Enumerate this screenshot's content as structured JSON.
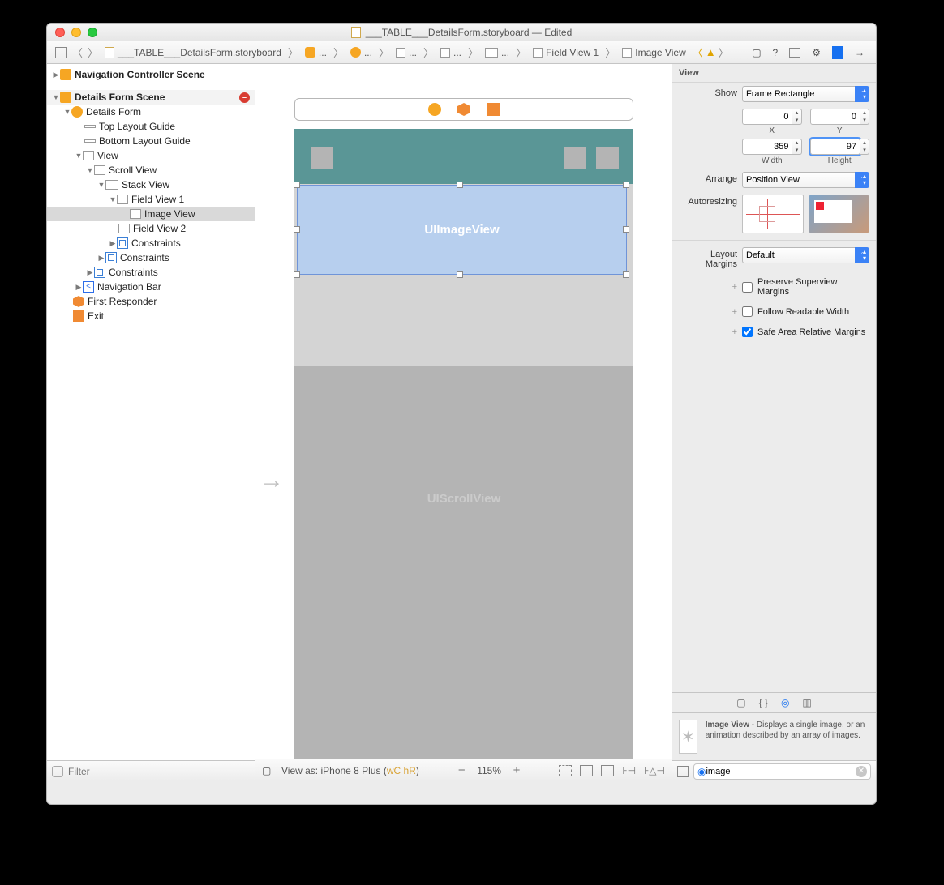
{
  "window": {
    "title": "___TABLE___DetailsForm.storyboard — Edited"
  },
  "breadcrumbs": {
    "file": "___TABLE___DetailsForm.storyboard",
    "p1": "...",
    "p2": "...",
    "p3": "...",
    "p4": "...",
    "p5": "...",
    "field": "Field View 1",
    "image": "Image View"
  },
  "outline": {
    "navScene": "Navigation Controller Scene",
    "detailsScene": "Details Form Scene",
    "items": {
      "detailsForm": "Details Form",
      "topGuide": "Top Layout Guide",
      "bottomGuide": "Bottom Layout Guide",
      "view": "View",
      "scrollView": "Scroll View",
      "stackView": "Stack View",
      "fieldView1": "Field View 1",
      "imageView": "Image View",
      "fieldView2": "Field View 2",
      "constraints1": "Constraints",
      "constraints2": "Constraints",
      "constraints3": "Constraints",
      "navBar": "Navigation Bar",
      "firstResponder": "First Responder",
      "exit": "Exit"
    },
    "filterPlaceholder": "Filter"
  },
  "canvas": {
    "imageViewLabel": "UIImageView",
    "scrollViewLabel": "UIScrollView",
    "footer": {
      "viewAs": "View as: iPhone 8 Plus (",
      "wc": "wC",
      "hr": " hR",
      "close": ")",
      "zoom": "115%"
    }
  },
  "inspector": {
    "header": "View",
    "show": {
      "label": "Show",
      "value": "Frame Rectangle"
    },
    "x": {
      "label": "X",
      "value": "0"
    },
    "y": {
      "label": "Y",
      "value": "0"
    },
    "width": {
      "label": "Width",
      "value": "359"
    },
    "height": {
      "label": "Height",
      "value": "97"
    },
    "arrange": {
      "label": "Arrange",
      "value": "Position View"
    },
    "autoresizing": "Autoresizing",
    "layoutMargins": {
      "label": "Layout Margins",
      "value": "Default"
    },
    "preserve": "Preserve Superview Margins",
    "readable": "Follow Readable Width",
    "safeArea": "Safe Area Relative Margins"
  },
  "library": {
    "item": {
      "title": "Image View",
      "desc": " - Displays a single image, or an animation described by an array of images."
    },
    "searchValue": "image"
  }
}
